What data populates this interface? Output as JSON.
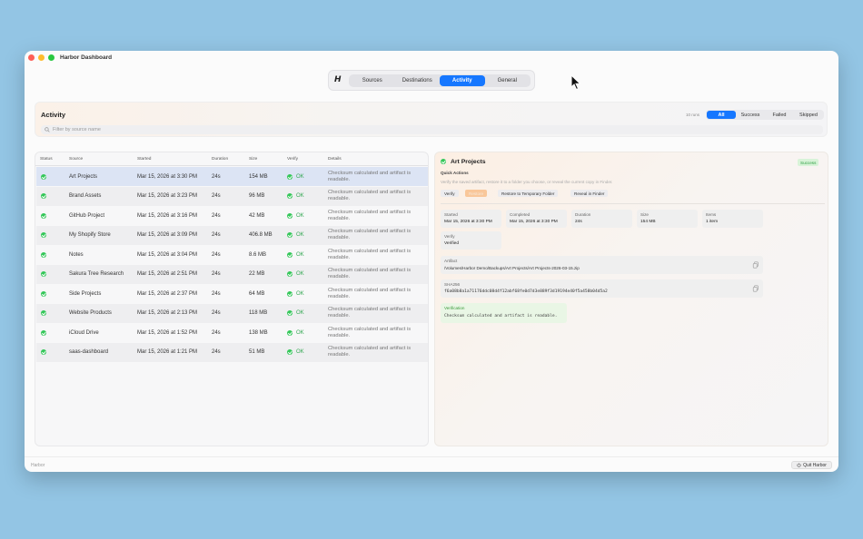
{
  "window": {
    "title": "Harbor Dashboard"
  },
  "nav": {
    "logo": "H",
    "tabs": [
      {
        "label": "Sources",
        "active": false
      },
      {
        "label": "Destinations",
        "active": false
      },
      {
        "label": "Activity",
        "active": true
      },
      {
        "label": "General",
        "active": false
      }
    ]
  },
  "activity": {
    "title": "Activity",
    "runs_count": "10 runs",
    "filters": [
      {
        "label": "All",
        "active": true
      },
      {
        "label": "Success",
        "active": false
      },
      {
        "label": "Failed",
        "active": false
      },
      {
        "label": "Skipped",
        "active": false
      }
    ],
    "search_placeholder": "Filter by source name"
  },
  "table": {
    "headers": [
      "Status",
      "Source",
      "Started",
      "Duration",
      "Size",
      "Verify",
      "Details"
    ],
    "rows": [
      {
        "source": "Art Projects",
        "started": "Mar 15, 2026 at 3:30 PM",
        "duration": "24s",
        "size": "154 MB",
        "verify": "OK",
        "details": "Checksum calculated and artifact is readable."
      },
      {
        "source": "Brand Assets",
        "started": "Mar 15, 2026 at 3:23 PM",
        "duration": "24s",
        "size": "96 MB",
        "verify": "OK",
        "details": "Checksum calculated and artifact is readable."
      },
      {
        "source": "GitHub Project",
        "started": "Mar 15, 2026 at 3:16 PM",
        "duration": "24s",
        "size": "42 MB",
        "verify": "OK",
        "details": "Checksum calculated and artifact is readable."
      },
      {
        "source": "My Shopify Store",
        "started": "Mar 15, 2026 at 3:09 PM",
        "duration": "24s",
        "size": "406.8 MB",
        "verify": "OK",
        "details": "Checksum calculated and artifact is readable."
      },
      {
        "source": "Notes",
        "started": "Mar 15, 2026 at 3:04 PM",
        "duration": "24s",
        "size": "8.6 MB",
        "verify": "OK",
        "details": "Checksum calculated and artifact is readable."
      },
      {
        "source": "Sakura Tree Research",
        "started": "Mar 15, 2026 at 2:51 PM",
        "duration": "24s",
        "size": "22 MB",
        "verify": "OK",
        "details": "Checksum calculated and artifact is readable."
      },
      {
        "source": "Side Projects",
        "started": "Mar 15, 2026 at 2:37 PM",
        "duration": "24s",
        "size": "64 MB",
        "verify": "OK",
        "details": "Checksum calculated and artifact is readable."
      },
      {
        "source": "Website Products",
        "started": "Mar 15, 2026 at 2:13 PM",
        "duration": "24s",
        "size": "118 MB",
        "verify": "OK",
        "details": "Checksum calculated and artifact is readable."
      },
      {
        "source": "iCloud Drive",
        "started": "Mar 15, 2026 at 1:52 PM",
        "duration": "24s",
        "size": "138 MB",
        "verify": "OK",
        "details": "Checksum calculated and artifact is readable."
      },
      {
        "source": "saas-dashboard",
        "started": "Mar 15, 2026 at 1:21 PM",
        "duration": "24s",
        "size": "51 MB",
        "verify": "OK",
        "details": "Checksum calculated and artifact is readable."
      }
    ]
  },
  "detail": {
    "title": "Art Projects",
    "status_badge": "Success",
    "quick_actions_label": "Quick Actions",
    "quick_actions_desc": "Verify the saved artifact, restore it to a folder you choose, or reveal the current copy in Finder.",
    "actions": [
      "Verify",
      "Restore",
      "Restore to Temporary Folder",
      "Reveal in Finder"
    ],
    "cards": [
      {
        "label": "Started",
        "value": "Mar 15, 2026 at 3:30 PM"
      },
      {
        "label": "Completed",
        "value": "Mar 15, 2026 at 3:30 PM"
      },
      {
        "label": "Duration",
        "value": "24s"
      },
      {
        "label": "Size",
        "value": "154 MB"
      },
      {
        "label": "Items",
        "value": "1 item"
      }
    ],
    "verify_card": {
      "label": "Verify",
      "value": "Verified"
    },
    "artifact": {
      "label": "Artifact",
      "value": "/Volumes/Harbor Demo/Backups/Art Projects/Art Projects-2026-03-15.zip"
    },
    "sha256": {
      "label": "SHA256",
      "value": "f6a08b8a1a71176ddc08d4f12abf68fe0d7d3e889f3d19194e40f5a458b04d5a2"
    },
    "verification": {
      "label": "Verification",
      "text": "Checksum calculated and artifact is readable."
    }
  },
  "footer": {
    "app_name": "Harbor",
    "quit_label": "Quit Harbor"
  },
  "colors": {
    "accent": "#1677ff",
    "success": "#34c759",
    "desktop": "#93c5e4"
  }
}
